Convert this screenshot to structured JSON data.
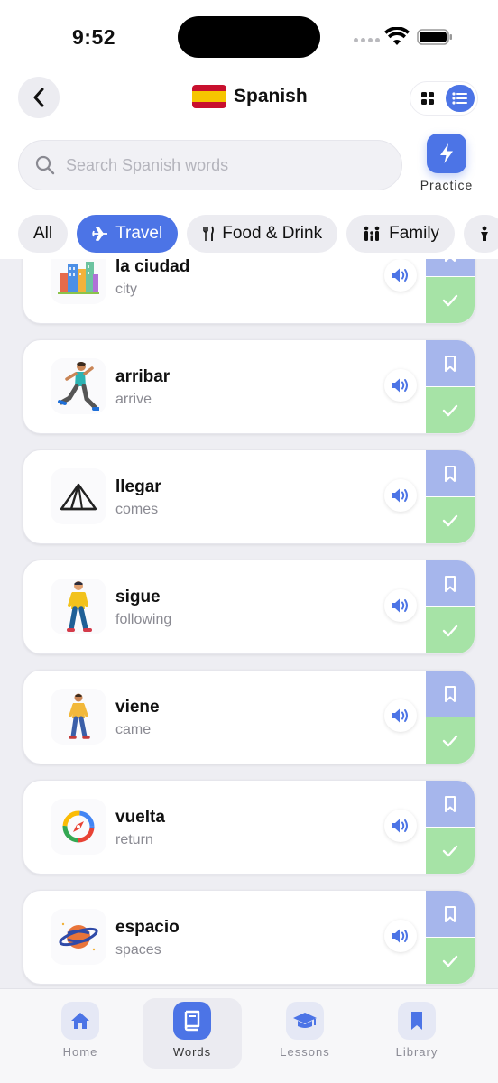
{
  "status_bar": {
    "time": "9:52"
  },
  "header": {
    "title": "Spanish",
    "flag_icon": "spain-flag-icon",
    "search_placeholder": "Search Spanish words",
    "practice_label": "Practice"
  },
  "filters": [
    {
      "label": "All",
      "icon": "",
      "active": false
    },
    {
      "label": "Travel",
      "icon": "airplane-icon",
      "active": true
    },
    {
      "label": "Food & Drink",
      "icon": "fork-knife-icon",
      "active": false
    },
    {
      "label": "Family",
      "icon": "family-icon",
      "active": false
    }
  ],
  "words": [
    {
      "word": "la ciudad",
      "translation": "city",
      "image": "city-buildings-icon"
    },
    {
      "word": "arribar",
      "translation": "arrive",
      "image": "running-man-icon"
    },
    {
      "word": "llegar",
      "translation": "comes",
      "image": "tent-icon"
    },
    {
      "word": "sigue",
      "translation": "following",
      "image": "walking-man-icon"
    },
    {
      "word": "viene",
      "translation": "came",
      "image": "walking-man-icon"
    },
    {
      "word": "vuelta",
      "translation": "return",
      "image": "compass-icon"
    },
    {
      "word": "espacio",
      "translation": "spaces",
      "image": "planet-icon"
    }
  ],
  "tabs": [
    {
      "label": "Home",
      "icon": "home-icon",
      "active": false
    },
    {
      "label": "Words",
      "icon": "book-icon",
      "active": true
    },
    {
      "label": "Lessons",
      "icon": "graduation-cap-icon",
      "active": false
    },
    {
      "label": "Library",
      "icon": "bookmark-icon",
      "active": false
    }
  ],
  "colors": {
    "accent": "#4c74e6",
    "bookmark_bg": "#a6b6ec",
    "known_bg": "#a6e3a6"
  }
}
